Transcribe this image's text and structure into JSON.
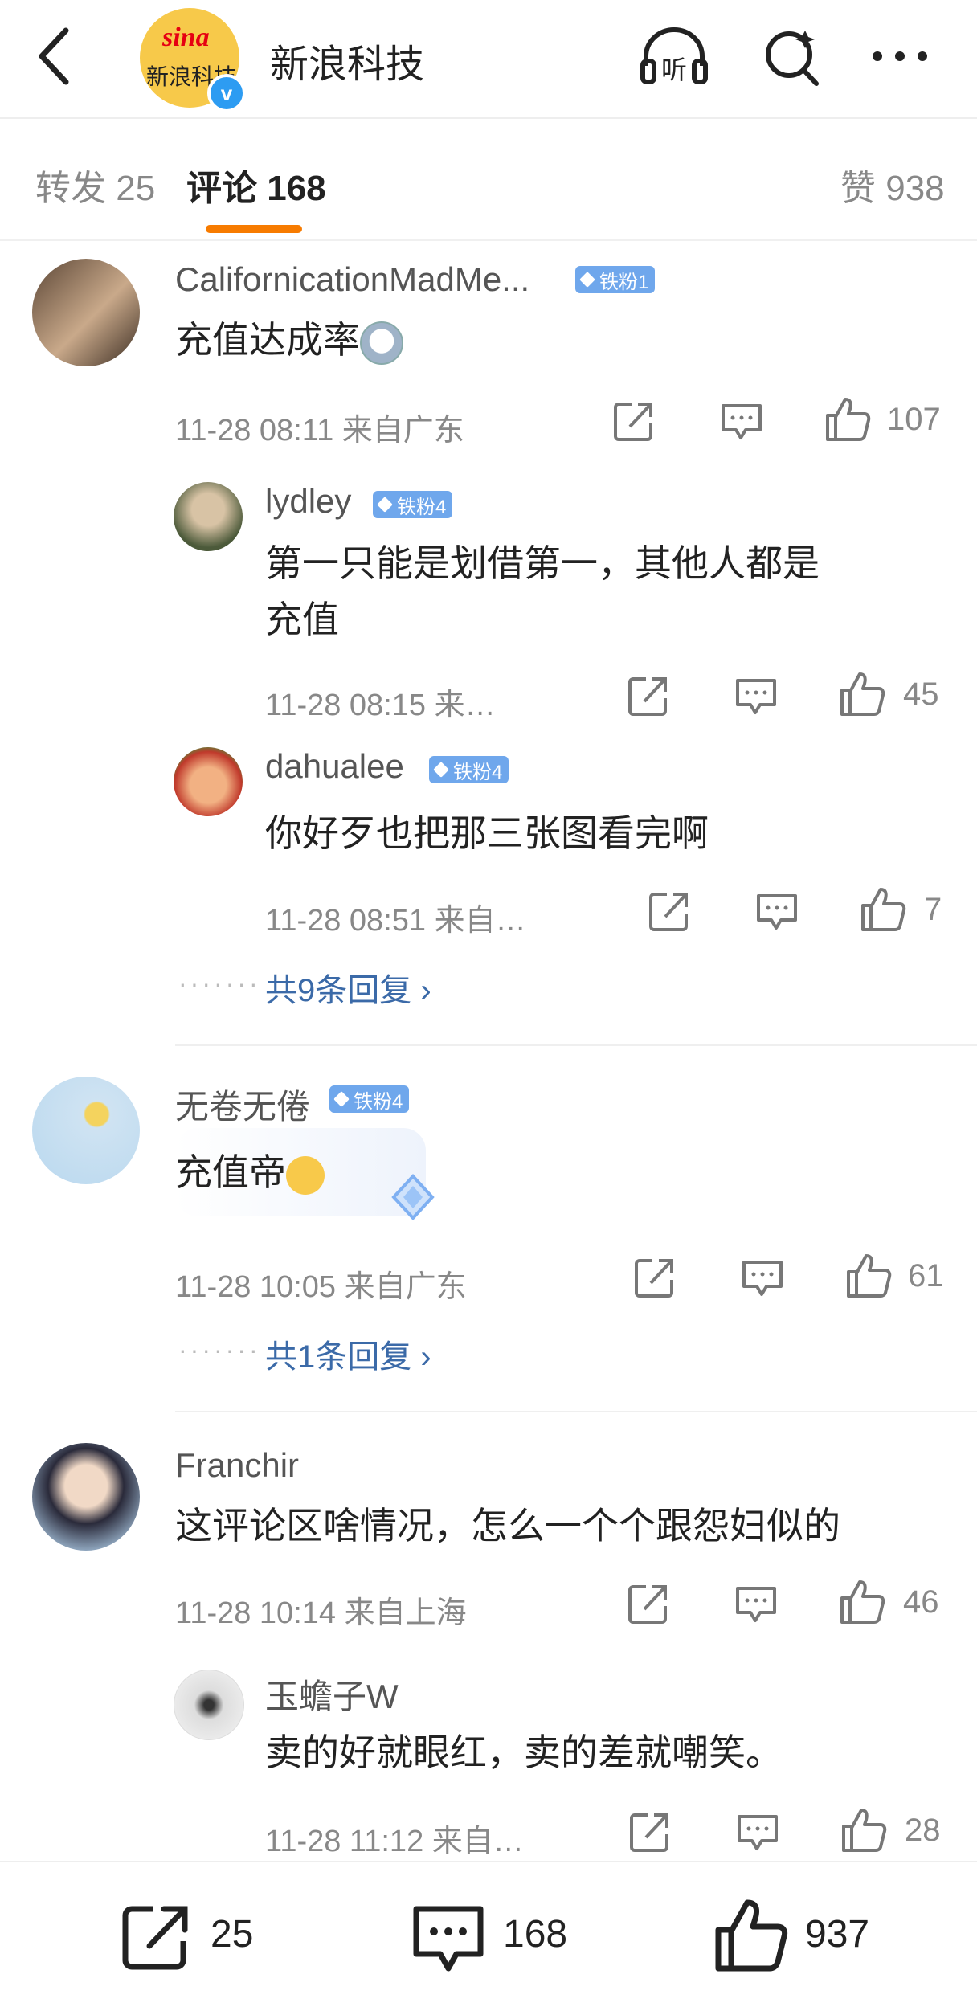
{
  "header": {
    "account_name": "新浪科技",
    "logo_text": "sina",
    "logo_sub": "新浪科技",
    "listen_label": "听"
  },
  "tabs": {
    "repost": "转发 25",
    "comments": "评论 168",
    "likes": "赞 938"
  },
  "comments": [
    {
      "user": "CalifornicationMadMe...",
      "badge": "铁粉1",
      "text": "充值达成率",
      "time": "11-28 08:11",
      "location": "来自广东",
      "likes": "107",
      "replies": [
        {
          "user": "lydley",
          "badge": "铁粉4",
          "text_line1": "第一只能是划借第一，其他人都是",
          "text_line2": "充值",
          "time": "11-28 08:15",
          "location": "来…",
          "likes": "45"
        },
        {
          "user": "dahualee",
          "badge": "铁粉4",
          "text": "你好歹也把那三张图看完啊",
          "time": "11-28 08:51",
          "location": "来自…",
          "likes": "7"
        }
      ],
      "more_replies": "共9条回复"
    },
    {
      "user": "无卷无倦",
      "badge": "铁粉4",
      "text": "充值帝",
      "time": "11-28 10:05",
      "location": "来自广东",
      "likes": "61",
      "more_replies": "共1条回复"
    },
    {
      "user": "Franchir",
      "text": "这评论区啥情况，怎么一个个跟怨妇似的",
      "time": "11-28 10:14",
      "location": "来自上海",
      "likes": "46",
      "replies": [
        {
          "user": "玉蟾子W",
          "text": "卖的好就眼红，卖的差就嘲笑。",
          "time": "11-28 11:12",
          "location": "来自…",
          "likes": "28"
        }
      ]
    }
  ],
  "bottom_bar": {
    "repost_count": "25",
    "comment_count": "168",
    "like_count": "937"
  },
  "colors": {
    "accent": "#f77b00",
    "badge": "#6fa7ec",
    "link": "#3b6aa8",
    "verified": "#2d9cf2"
  }
}
